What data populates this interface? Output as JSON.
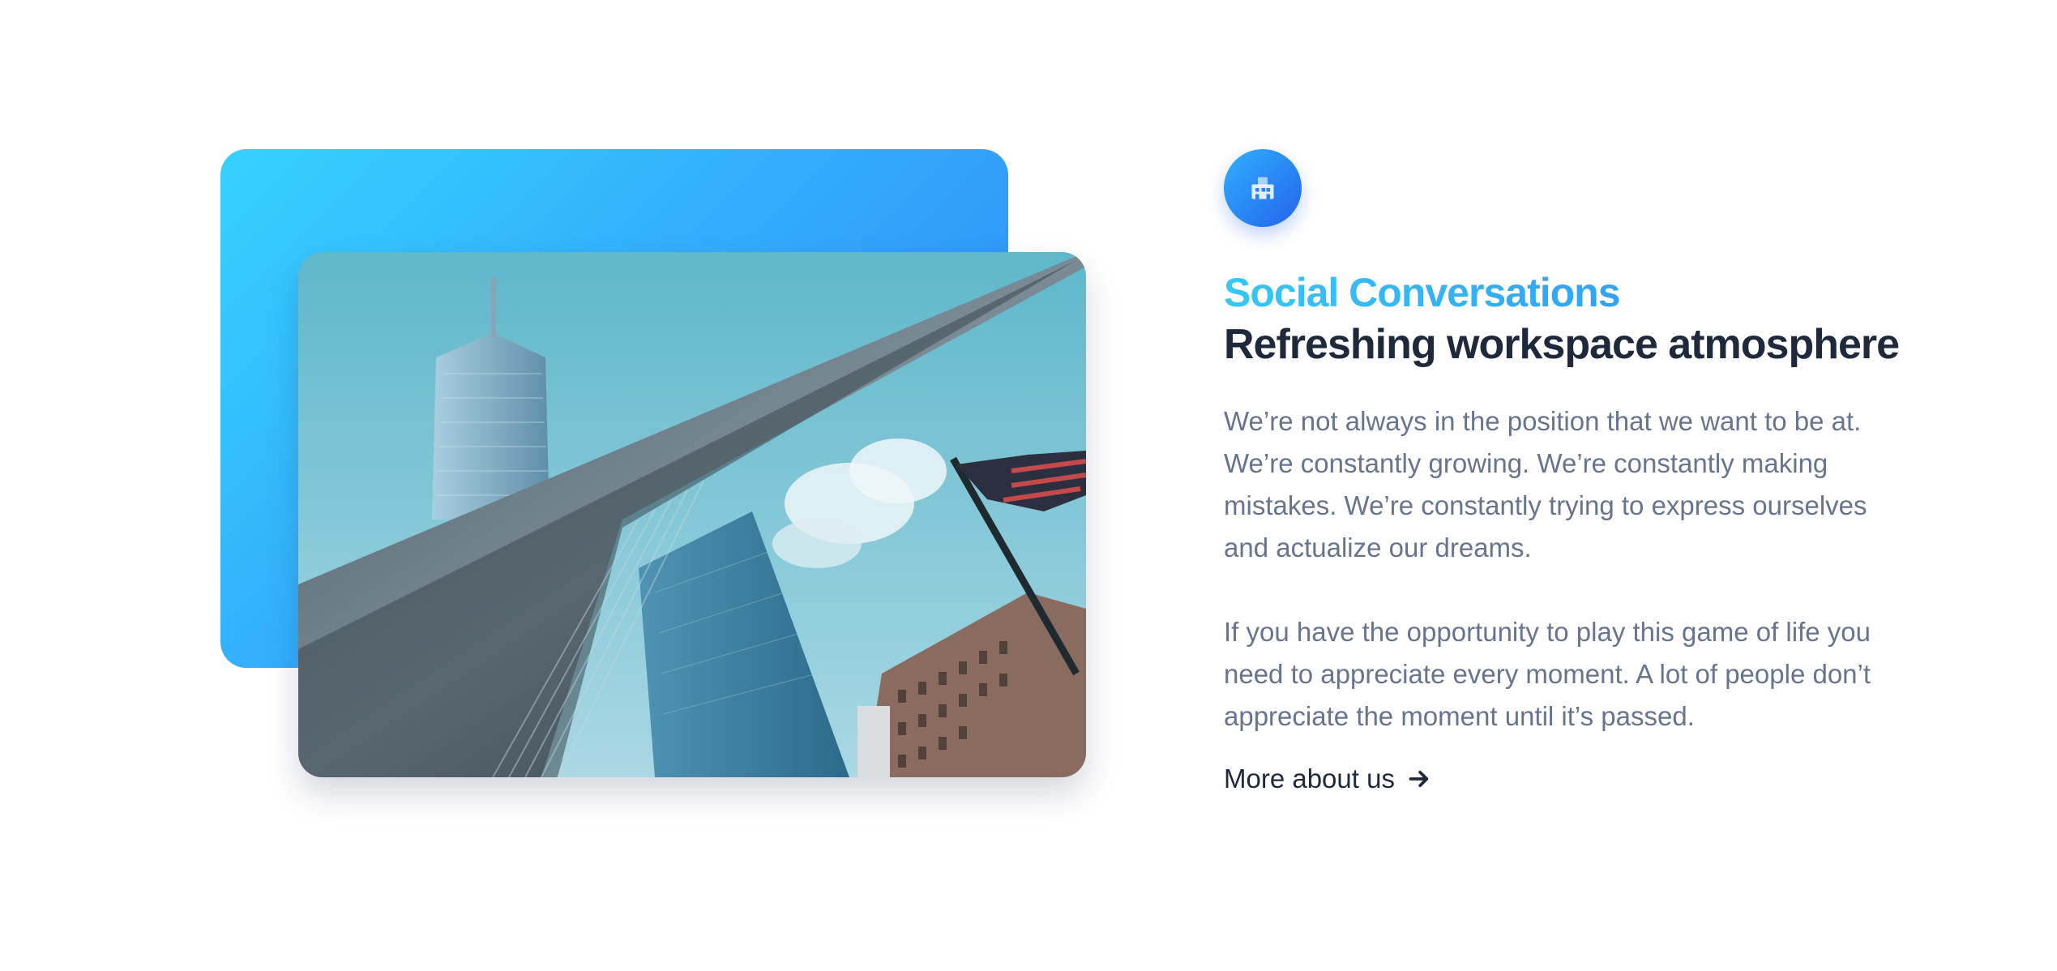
{
  "content": {
    "eyebrow": "Social Conversations",
    "title": "Refreshing workspace atmosphere",
    "paragraph_1": "We’re not always in the position that we want to be at. We’re constantly growing. We’re constantly making mistakes. We’re constantly trying to express ourselves and actualize our dreams.",
    "paragraph_2": "If you have the opportunity to play this game of life you need to appreciate every moment. A lot of people don’t appreciate the moment until it’s passed.",
    "link_label": "More about us",
    "link_icon": "arrow-right-icon",
    "badge_icon": "building-icon"
  },
  "colors": {
    "gradient_start": "#36d1ff",
    "gradient_end": "#2f80f7",
    "heading": "#1e2a3b",
    "body_text": "#67748e"
  }
}
